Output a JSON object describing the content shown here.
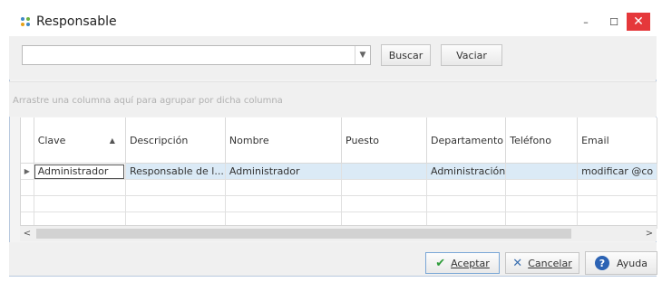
{
  "window": {
    "title": "Responsable",
    "close_glyph": "✕",
    "minimize_glyph": "–",
    "maximize_glyph": "☐"
  },
  "toolbar": {
    "combo_value": "",
    "buscar_label": "Buscar",
    "vaciar_label": "Vaciar"
  },
  "group_hint": "Arrastre una columna aquí para agrupar por dicha columna",
  "grid": {
    "columns": [
      "Clave",
      "Descripción",
      "Nombre",
      "Puesto",
      "Departamento",
      "Teléfono",
      "Email"
    ],
    "sorted_column": "Clave",
    "sort_direction": "asc",
    "rows": [
      [
        "Administrador",
        "Responsable de l...",
        "Administrador",
        "",
        "Administración",
        "",
        "modificar @co"
      ]
    ]
  },
  "footer": {
    "aceptar_label": "Aceptar",
    "cancelar_label": "Cancelar",
    "ayuda_label": "Ayuda"
  }
}
